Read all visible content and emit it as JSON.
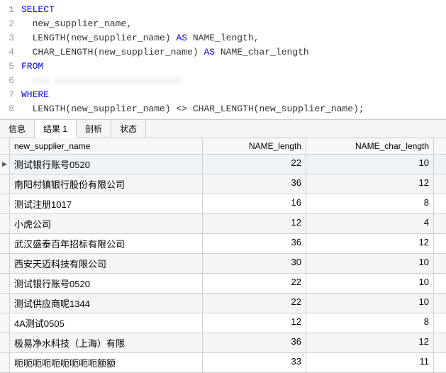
{
  "code": {
    "lines": [
      {
        "n": "1",
        "pre": "",
        "kw": "SELECT",
        "rest": ""
      },
      {
        "n": "2",
        "pre": "  ",
        "kw": "",
        "rest": "new_supplier_name,"
      },
      {
        "n": "3",
        "pre": "  ",
        "kw": "",
        "rest": "LENGTH(new_supplier_name) ",
        "kw2": "AS",
        "rest2": " NAME_length,"
      },
      {
        "n": "4",
        "pre": "  ",
        "kw": "",
        "rest": "CHAR_LENGTH(new_supplier_name) ",
        "kw2": "AS",
        "rest2": " NAME_char_length"
      },
      {
        "n": "5",
        "pre": "",
        "kw": "FROM",
        "rest": ""
      },
      {
        "n": "6",
        "pre": "  ",
        "kw": "",
        "rest": "",
        "blur": "xxx_xxxxxxxxxxxxxxxxxxxxxxx"
      },
      {
        "n": "7",
        "pre": "",
        "kw": "WHERE",
        "rest": ""
      },
      {
        "n": "8",
        "pre": "  ",
        "kw": "",
        "rest": "LENGTH(new_supplier_name) <> CHAR_LENGTH(new_supplier_name);"
      }
    ]
  },
  "tabs": [
    "信息",
    "结果 1",
    "剖析",
    "状态"
  ],
  "active_tab": 1,
  "columns": [
    "new_supplier_name",
    "NAME_length",
    "NAME_char_length"
  ],
  "rows": [
    {
      "name": "测试银行账号0520",
      "len": "22",
      "clen": "10",
      "sel": true
    },
    {
      "name": "南阳村镇银行股份有限公司",
      "len": "36",
      "clen": "12"
    },
    {
      "name": "测试注册1017",
      "len": "16",
      "clen": "8"
    },
    {
      "name": "小虎公司",
      "len": "12",
      "clen": "4"
    },
    {
      "name": "武汉盛泰百年招标有限公司",
      "len": "36",
      "clen": "12"
    },
    {
      "name": "西安天迈科技有限公司",
      "len": "30",
      "clen": "10"
    },
    {
      "name": "测试银行账号0520",
      "len": "22",
      "clen": "10"
    },
    {
      "name": "测试供应商呢1344",
      "len": "22",
      "clen": "10"
    },
    {
      "name": "4A测试0505",
      "len": "12",
      "clen": "8"
    },
    {
      "name": "极易净水科技（上海）有限",
      "len": "36",
      "clen": "12"
    },
    {
      "name": "呃呃呃呃呃呃呃呃呃额额",
      "len": "33",
      "clen": "11"
    }
  ]
}
